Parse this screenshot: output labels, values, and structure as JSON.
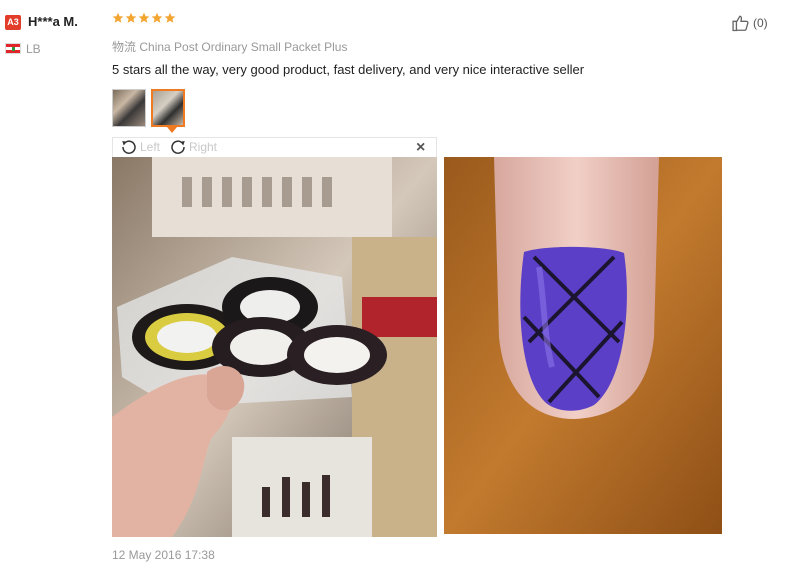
{
  "reviewer": {
    "level_badge": "A3",
    "name": "H***a M.",
    "country": "LB"
  },
  "rating": {
    "stars": 5,
    "max": 5,
    "star_color": "#f3a531"
  },
  "helpful": {
    "icon": "thumbs-up-icon",
    "count": "(0)"
  },
  "logistics": {
    "label": "物流",
    "value": "China Post Ordinary Small Packet Plus"
  },
  "review_text": "5 stars all the way, very good product, fast delivery, and very nice interactive seller",
  "viewer": {
    "rotate_left_label": "Left",
    "rotate_right_label": "Right",
    "close_label": "×"
  },
  "timestamp": "12 May 2016 17:38",
  "colors": {
    "accent": "#f07a21",
    "badge": "#e23d2b"
  }
}
